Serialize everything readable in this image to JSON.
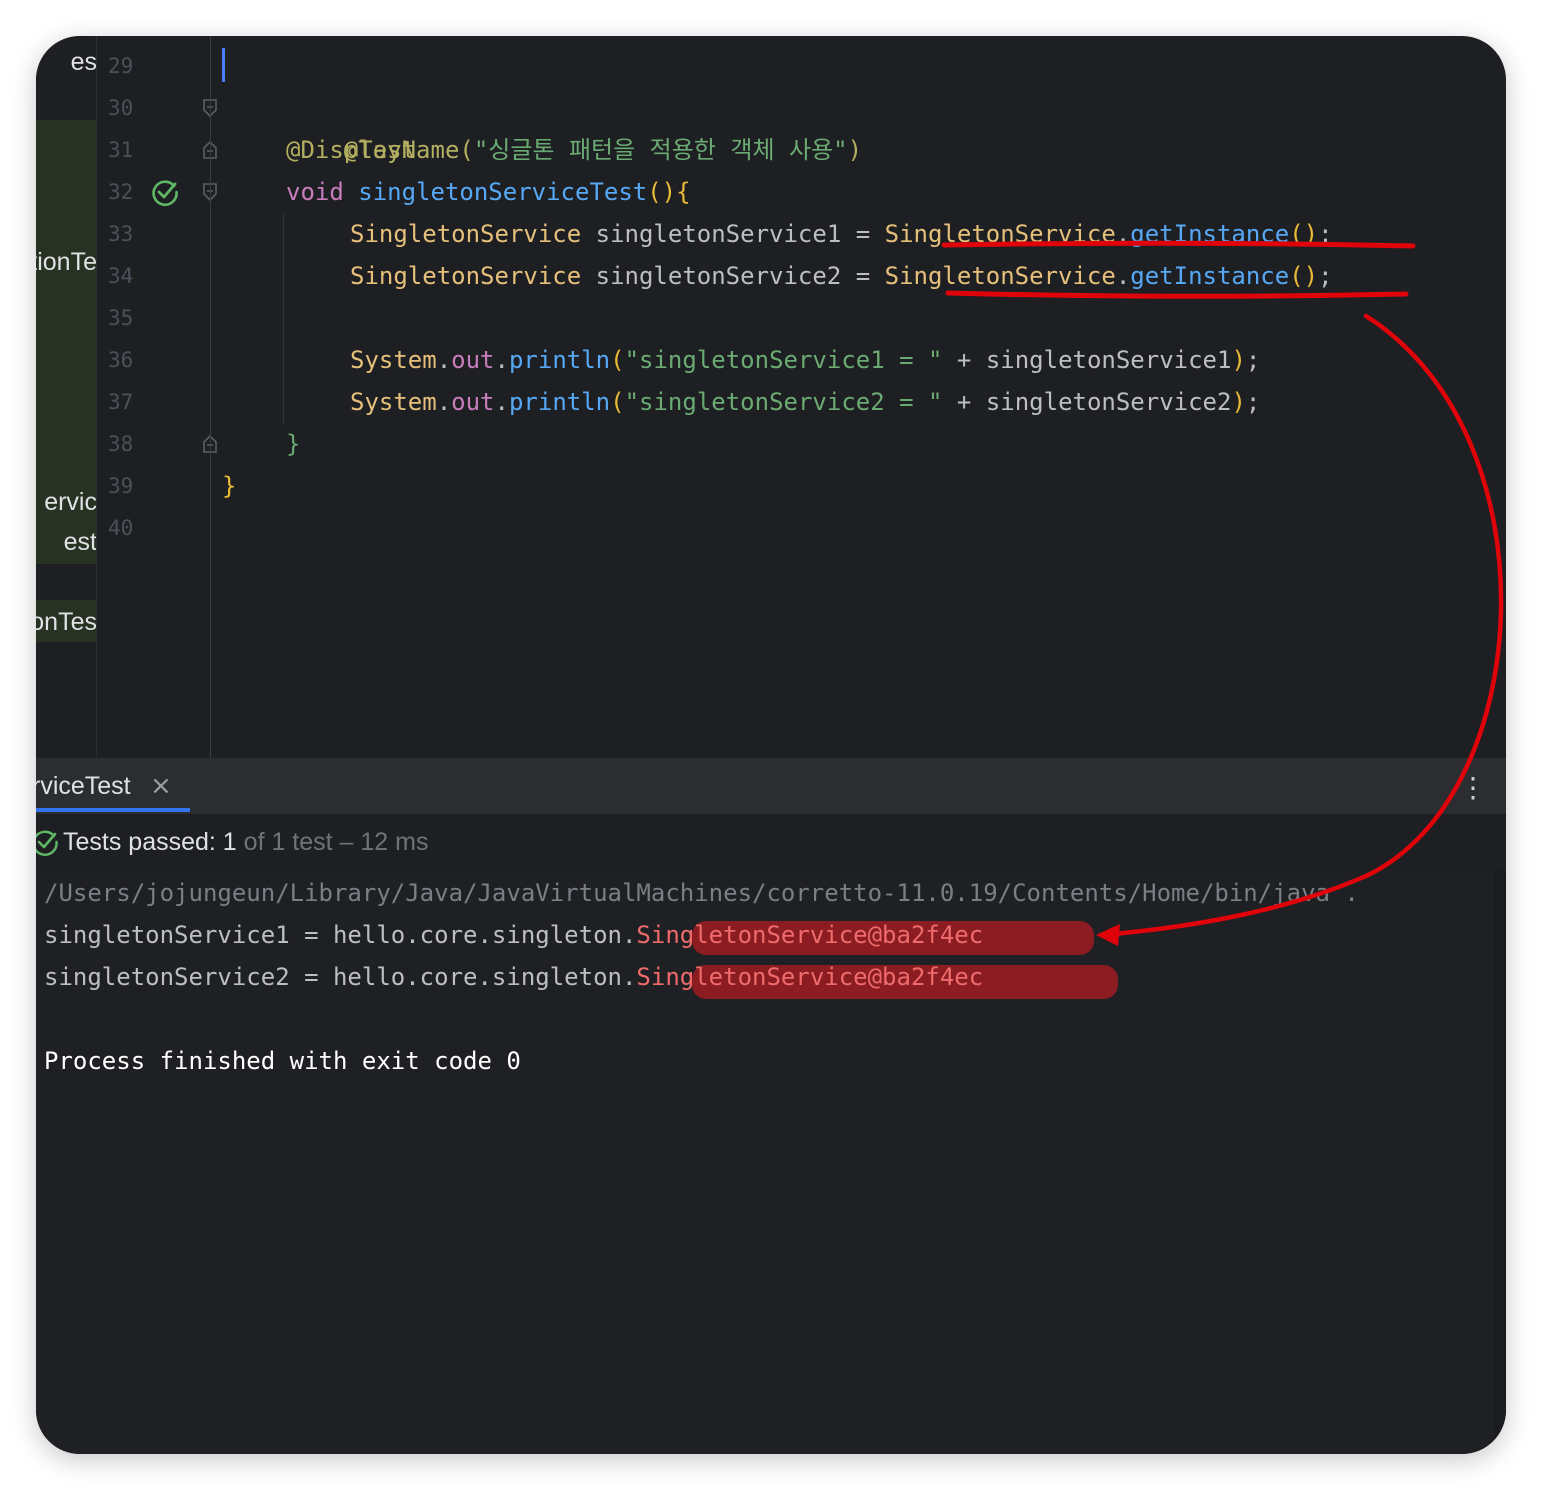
{
  "project_panel": {
    "items": [
      "es",
      "tionTe",
      "ervic",
      "est",
      "onTes"
    ]
  },
  "editor": {
    "line_numbers": [
      "29",
      "30",
      "31",
      "32",
      "33",
      "34",
      "35",
      "36",
      "37",
      "38",
      "39",
      "40"
    ],
    "code": {
      "l30": "@Test",
      "l31_ann": "@DisplayName(",
      "l31_str": "\"싱글톤 패턴을 적용한 객체 사용\"",
      "l31_close": ")",
      "l32_kw": "void",
      "l32_fn": "singletonServiceTest",
      "l32_paren": "(){",
      "l33_type": "SingletonService",
      "l33_var": " singletonService1 = ",
      "l34_var": " singletonService2 = ",
      "call_cls": "SingletonService",
      "call_dot": ".",
      "call_fn": "getInstance",
      "call_paren": "()",
      "semi": ";",
      "sys": "System",
      "dot": ".",
      "out": "out",
      "println": "println",
      "lp": "(",
      "l36_str": "\"singletonService1 = \"",
      "l36_rest": " + singletonService1",
      "l37_str": "\"singletonService2 = \"",
      "l37_rest": " + singletonService2",
      "rp": ")",
      "l38": "}",
      "l39": "}"
    }
  },
  "run_panel": {
    "tab_label": "rviceTest",
    "tab_close": "×",
    "more_icon": "⋮",
    "status_passed": "Tests passed: 1",
    "status_of": " of 1 test",
    "status_time": " – 12 ms",
    "output": {
      "path": "/Users/jojungeun/Library/Java/JavaVirtualMachines/corretto-11.0.19/Contents/Home/bin/java .",
      "line1_prefix": "singletonService1 = hello.core.singleton.",
      "line1_obj": "SingletonService@ba2f4ec",
      "line2_prefix": "singletonService2 = hello.core.singleton.",
      "line2_obj": "SingletonService@ba2f4ec",
      "finish": "Process finished with exit code 0"
    }
  },
  "colors": {
    "annotation_red": "#e0030a",
    "highlight_red": "#8a1c22",
    "accent_blue": "#3574f0",
    "pass_green": "#5fb865"
  }
}
